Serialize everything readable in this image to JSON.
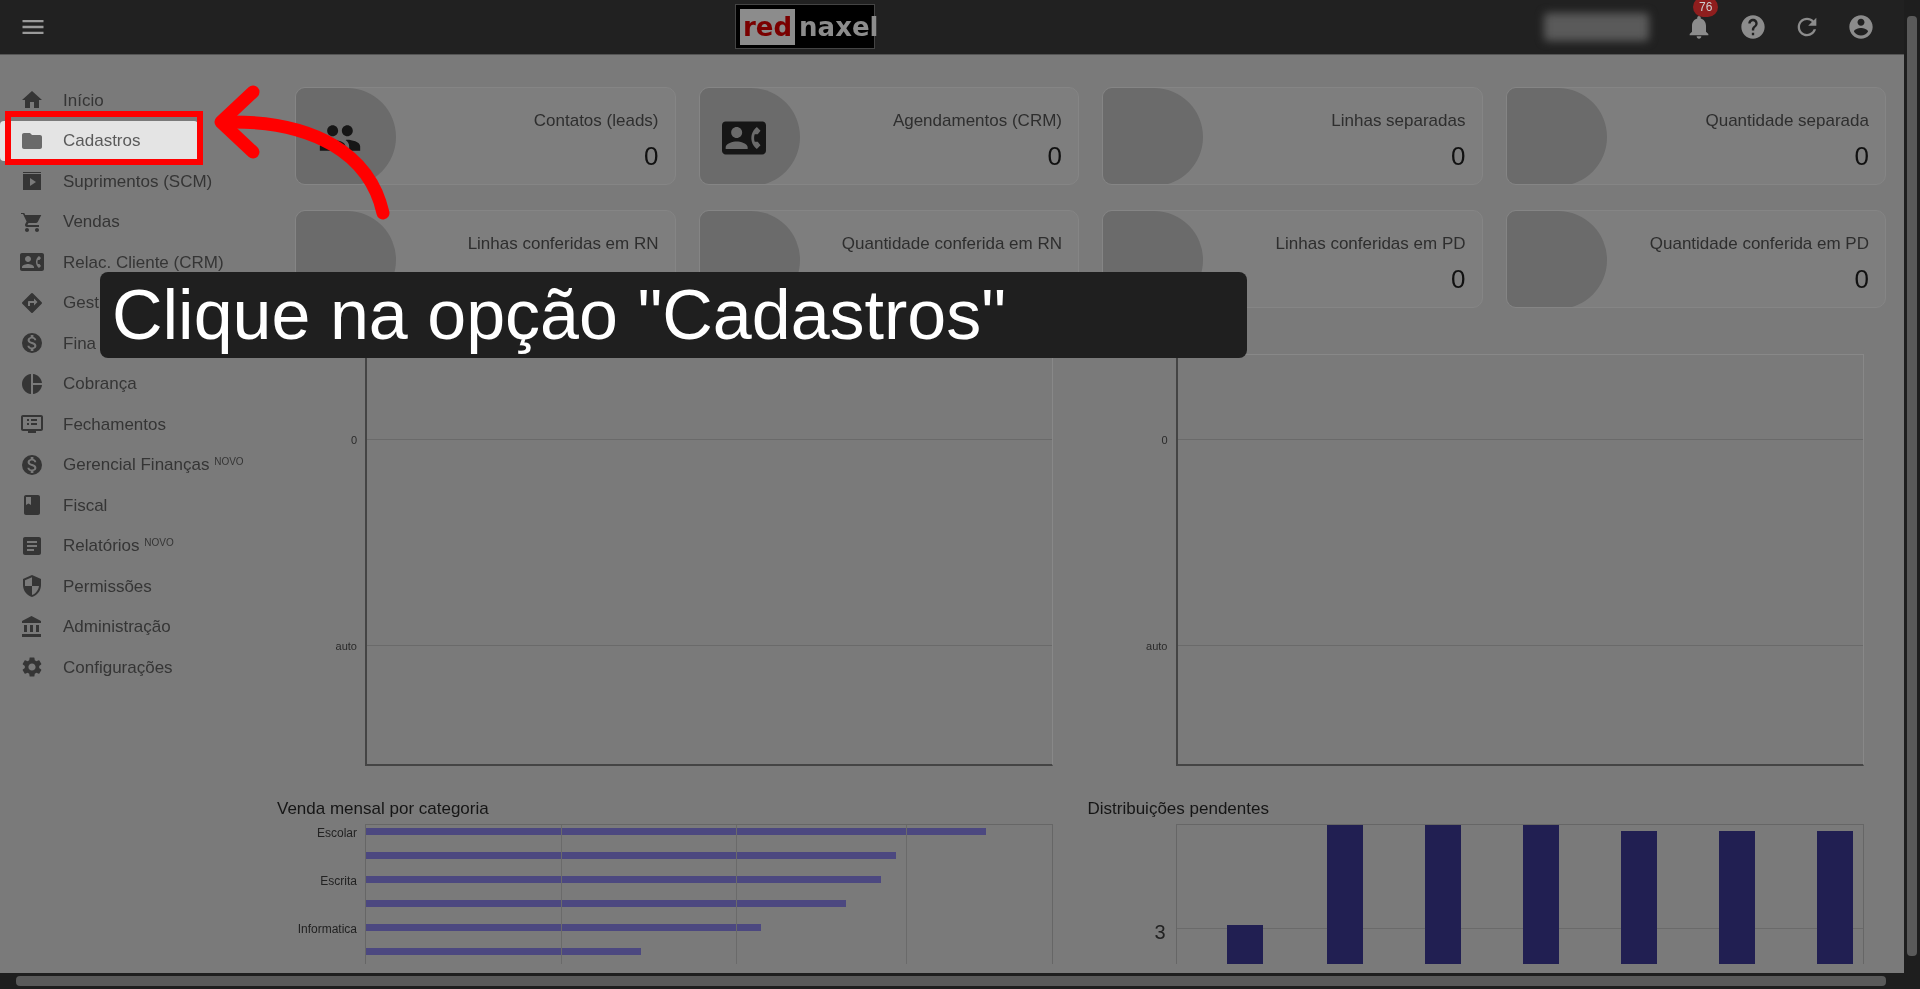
{
  "top_bar": {
    "logo": {
      "left": "red",
      "right": "naxel"
    },
    "notifications_badge": "76"
  },
  "sidebar": {
    "items": [
      {
        "label": "Início",
        "selected": false
      },
      {
        "label": "Cadastros",
        "selected": true
      },
      {
        "label": "Suprimentos (SCM)",
        "selected": false
      },
      {
        "label": "Vendas",
        "selected": false
      },
      {
        "label": "Relac. Cliente (CRM)",
        "selected": false
      },
      {
        "label": "Gest",
        "selected": false
      },
      {
        "label": "Fina",
        "selected": false
      },
      {
        "label": "Cobrança",
        "selected": false
      },
      {
        "label": "Fechamentos",
        "selected": false
      },
      {
        "label": "Gerencial Finanças $^{NOVO}$",
        "selected": false
      },
      {
        "label": "Fiscal",
        "selected": false
      },
      {
        "label": "Relatórios $^{NOVO}$",
        "selected": false
      },
      {
        "label": "Permissões",
        "selected": false
      },
      {
        "label": "Administração",
        "selected": false
      },
      {
        "label": "Configurações",
        "selected": false
      }
    ]
  },
  "cards": [
    {
      "label": "Contatos (leads)",
      "value": "0",
      "kind": "people"
    },
    {
      "label": "Agendamentos (CRM)",
      "value": "0",
      "kind": "contact"
    },
    {
      "label": "Linhas separadas",
      "value": "0",
      "kind": "plain"
    },
    {
      "label": "Quantidade separada",
      "value": "0",
      "kind": "plain"
    },
    {
      "label": "Linhas conferidas em RN",
      "kind": "plain"
    },
    {
      "label": "Quantidade conferida em RN",
      "kind": "plain"
    },
    {
      "label": "Linhas conferidas em PD",
      "value": "0",
      "kind": "plain"
    },
    {
      "label": "Quantidade conferida em PD",
      "value": "0",
      "kind": "plain"
    }
  ],
  "charts": [
    {
      "kind": "empty",
      "y_labels": [
        "0",
        "auto"
      ]
    },
    {
      "kind": "empty",
      "y_labels": [
        "0",
        "auto"
      ]
    },
    {
      "title": "Venda mensal por categoria",
      "kind": "hbar",
      "y_labels": [
        "Escolar",
        "Escrita",
        "Informatica"
      ]
    },
    {
      "title": "Distribuições pendentes",
      "kind": "vbar",
      "y_labels": [
        "3"
      ]
    }
  ],
  "tutorial_caption": "Clique na opção \"Cadastros\""
}
